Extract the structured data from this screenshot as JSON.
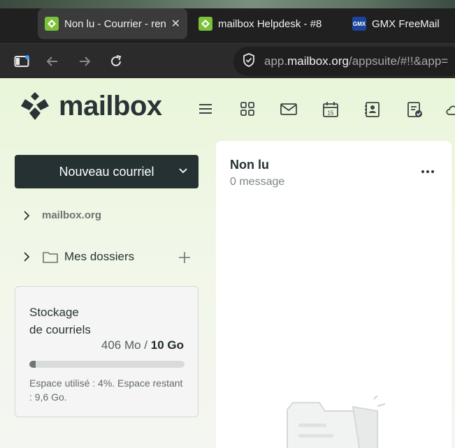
{
  "browser": {
    "tabs": [
      {
        "title": "Non lu - Courrier - ren",
        "favicon": "mailbox-icon",
        "active": true
      },
      {
        "title": "mailbox Helpdesk - #8",
        "favicon": "mailbox-icon",
        "active": false
      },
      {
        "title": "GMX FreeMail",
        "favicon": "gmx-icon",
        "active": false
      }
    ],
    "gmx_badge": "GMX",
    "close_glyph": "✕",
    "address": {
      "prefix": "app.",
      "domain": "mailbox.org",
      "path": "/appsuite/#!!&app="
    }
  },
  "app": {
    "logo_text": "mailbox",
    "header_icons": [
      "menu-icon",
      "apps-grid-icon",
      "mail-icon",
      "calendar-icon",
      "contacts-icon",
      "tasks-icon",
      "cloud-icon"
    ],
    "calendar_day": "15"
  },
  "sidebar": {
    "new_mail_label": "Nouveau courriel",
    "account_label": "mailbox.org",
    "folders_label": "Mes dossiers",
    "storage": {
      "label": "Stockage de courriels",
      "used": "406 Mo",
      "separator": " / ",
      "total": "10 Go",
      "used_fraction": 0.04,
      "note": "Espace utilisé : 4%. Espace restant : 9,6 Go."
    }
  },
  "list": {
    "folder_title": "Non lu",
    "message_count": "0 message"
  },
  "colors": {
    "brand_dark": "#253133",
    "accent_green": "#7bc23b",
    "gmx_blue": "#1c449b"
  }
}
